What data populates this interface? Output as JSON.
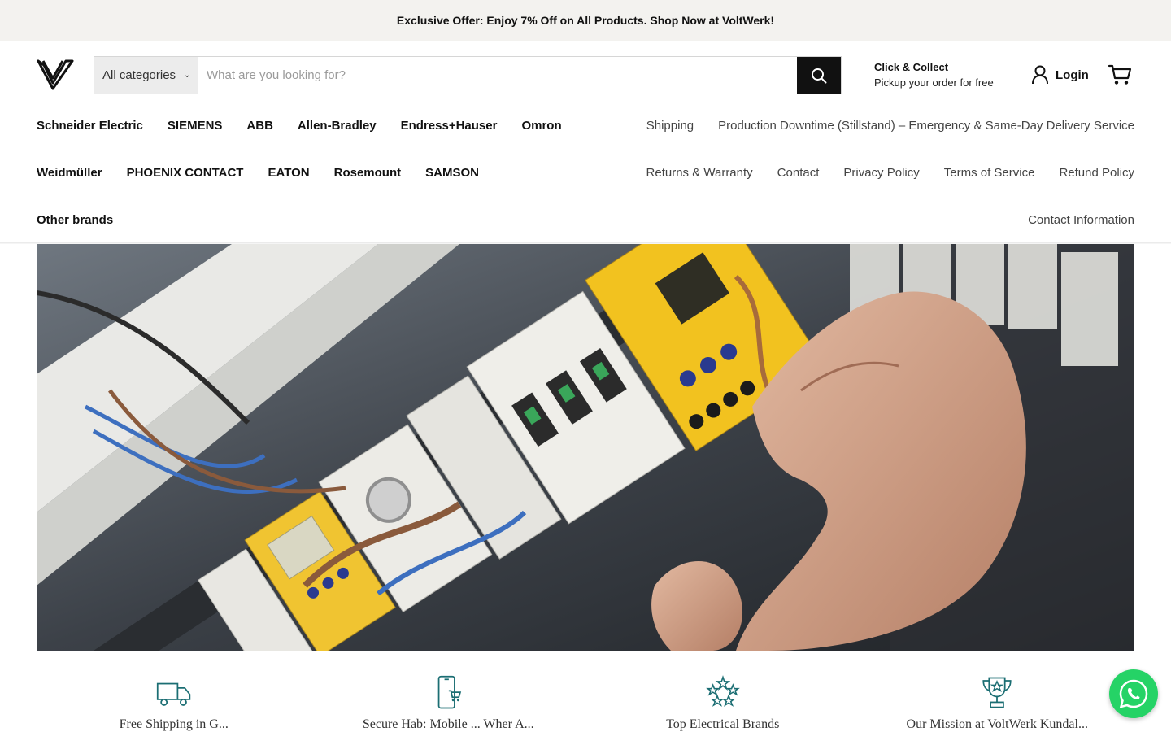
{
  "announcement": "Exclusive Offer: Enjoy 7% Off on All Products. Shop Now at VoltWerk!",
  "search": {
    "category": "All categories",
    "placeholder": "What are you looking for?"
  },
  "collect": {
    "title": "Click & Collect",
    "subtitle": "Pickup your order for free"
  },
  "account": {
    "login": "Login"
  },
  "nav": {
    "row1_brands": [
      "Schneider Electric",
      "SIEMENS",
      "ABB",
      "Allen-Bradley",
      "Endress+Hauser",
      "Omron"
    ],
    "row1_links": [
      "Shipping",
      "Production Downtime (Stillstand) – Emergency & Same-Day Delivery Service"
    ],
    "row2_brands": [
      "Weidmüller",
      "PHOENIX CONTACT",
      "EATON",
      "Rosemount",
      "SAMSON"
    ],
    "row2_links": [
      "Returns & Warranty",
      "Contact",
      "Privacy Policy",
      "Terms of Service",
      "Refund Policy"
    ],
    "row3_brands": [
      "Other brands"
    ],
    "row3_links": [
      "Contact Information"
    ]
  },
  "features": [
    {
      "icon": "delivery-truck-icon",
      "label": "Free Shipping in G..."
    },
    {
      "icon": "mobile-cart-icon",
      "label": "Secure Hab: Mobile ... Wher A..."
    },
    {
      "icon": "star-rating-icon",
      "label": "Top Electrical Brands"
    },
    {
      "icon": "trophy-icon",
      "label": "Our Mission at VoltWerk Kundal..."
    }
  ],
  "colors": {
    "announce_bg": "#f3f2ef",
    "accent_teal": "#1b6e73",
    "search_button": "#111111",
    "whatsapp": "#25d366"
  }
}
